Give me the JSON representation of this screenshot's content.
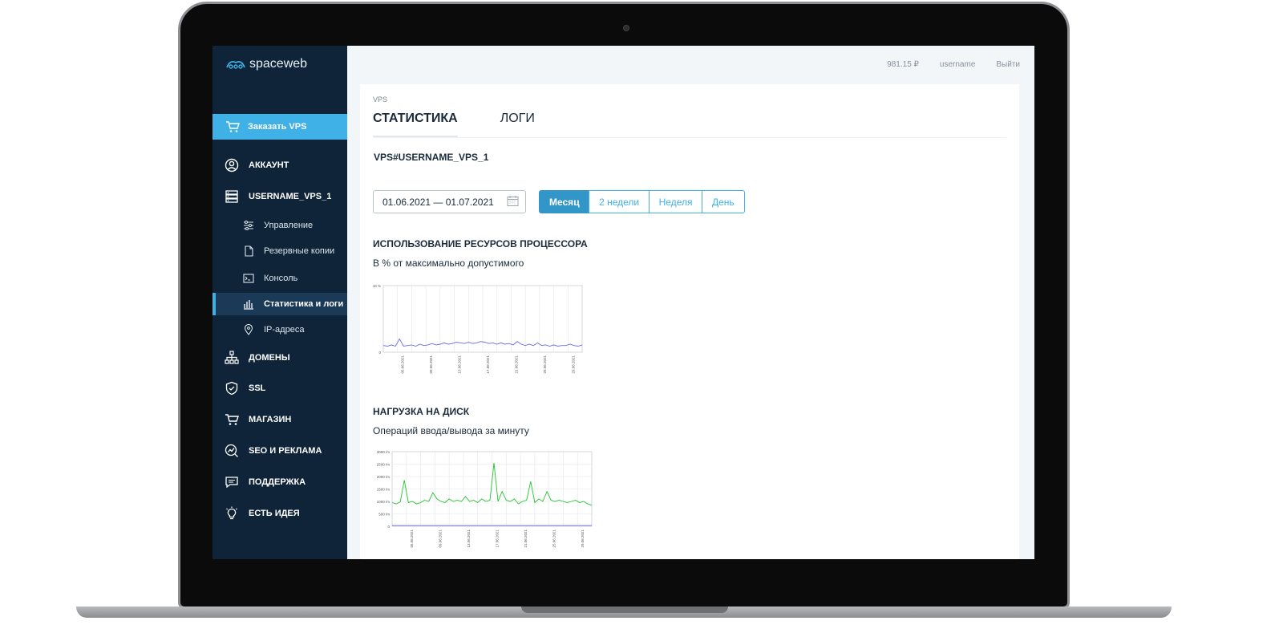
{
  "brand": {
    "name": "spaceweb"
  },
  "sidebar": {
    "order_label": "Заказать VPS",
    "items": [
      {
        "label": "АККАУНТ",
        "icon": "user-circle-icon"
      },
      {
        "label": "USERNAME_VPS_1",
        "icon": "server-icon"
      }
    ],
    "subitems": [
      {
        "label": "Управление",
        "icon": "sliders-icon"
      },
      {
        "label": "Резервные копии",
        "icon": "file-icon"
      },
      {
        "label": "Консоль",
        "icon": "terminal-icon"
      },
      {
        "label": "Статистика и логи",
        "icon": "bar-chart-icon",
        "active": true
      },
      {
        "label": "IP-адреса",
        "icon": "location-pin-icon"
      }
    ],
    "sections": [
      {
        "label": "ДОМЕНЫ",
        "icon": "sitemap-icon"
      },
      {
        "label": "SSL",
        "icon": "shield-icon"
      },
      {
        "label": "МАГАЗИН",
        "icon": "cart-icon"
      },
      {
        "label": "SEO И РЕКЛАМА",
        "icon": "seo-icon"
      },
      {
        "label": "ПОДДЕРЖКА",
        "icon": "chat-icon"
      },
      {
        "label": "ЕСТЬ ИДЕЯ",
        "icon": "lightbulb-icon"
      }
    ]
  },
  "topbar": {
    "balance": "981.15 ₽",
    "username": "username",
    "logout": "Выйти"
  },
  "breadcrumb": "VPS",
  "tabs": [
    {
      "label": "СТАТИСТИКА",
      "active": true
    },
    {
      "label": "ЛОГИ",
      "active": false
    }
  ],
  "vps_name": "VPS#USERNAME_VPS_1",
  "date_range": "01.06.2021 — 01.07.2021",
  "periods": [
    {
      "label": "Месяц",
      "active": true
    },
    {
      "label": "2 недели",
      "active": false
    },
    {
      "label": "Неделя",
      "active": false
    },
    {
      "label": "День",
      "active": false
    }
  ],
  "cpu": {
    "title": "ИСПОЛЬЗОВАНИЕ РЕСУРСОВ ПРОЦЕССОРА",
    "subtitle": "В % от максимально допустимого"
  },
  "disk": {
    "title": "НАГРУЗКА НА ДИСК",
    "subtitle": "Операций ввода/вывода за минуту"
  },
  "colors": {
    "accent": "#3fb1e6",
    "sidebar_bg": "#0f2438",
    "cpu_line": "#6a6ae8",
    "disk_line": "#22c32e"
  },
  "chart_data": [
    {
      "type": "line",
      "ylim": [
        0,
        10
      ],
      "ytick_labels": [
        "10 %",
        "0"
      ],
      "xtick_labels": [
        "05.06.2021",
        "09.06.2021",
        "13.06.2021",
        "17.06.2021",
        "21.06.2021",
        "25.06.2021",
        "29.06.2021"
      ],
      "series": [
        {
          "color": "#6a6ae8",
          "values": [
            1.0,
            0.9,
            1.1,
            0.9,
            2.0,
            0.9,
            1.0,
            1.1,
            0.9,
            1.2,
            1.0,
            1.1,
            1.3,
            1.1,
            1.2,
            1.4,
            1.2,
            1.3,
            1.5,
            1.4,
            1.3,
            1.5,
            1.3,
            1.4,
            1.6,
            1.5,
            1.3,
            1.4,
            1.2,
            1.4,
            1.2,
            1.3,
            1.1,
            1.6,
            1.2,
            1.0,
            1.2,
            1.0,
            1.4,
            1.0,
            1.1,
            0.9,
            1.1,
            0.9,
            1.0,
            1.0,
            1.2,
            1.0,
            0.9,
            1.1
          ]
        }
      ]
    },
    {
      "type": "line",
      "ylim": [
        0,
        3000
      ],
      "ytick_labels": [
        "3000 /m",
        "2500 /m",
        "2000 /m",
        "1500 /m",
        "1000 /m",
        "500 /m",
        "0"
      ],
      "xtick_labels": [
        "05.06.2021",
        "09.06.2021",
        "13.06.2021",
        "17.06.2021",
        "21.06.2021",
        "25.06.2021",
        "29.06.2021"
      ],
      "series": [
        {
          "color": "#22c32e",
          "values": [
            950,
            900,
            980,
            1850,
            950,
            1000,
            900,
            950,
            1050,
            1000,
            1350,
            1100,
            1000,
            950,
            1100,
            1000,
            1050,
            1000,
            1200,
            1000,
            1050,
            950,
            1100,
            1000,
            1050,
            2550,
            1000,
            1400,
            1050,
            1000,
            1100,
            900,
            1000,
            1050,
            1800,
            950,
            1100,
            1000,
            1400,
            1050,
            1000,
            1050,
            1000,
            950,
            1000,
            1050,
            950,
            1000,
            900,
            850
          ]
        },
        {
          "color": "#6a6ae8",
          "values": [
            30,
            30,
            30,
            30,
            30,
            30,
            30,
            30,
            30,
            30,
            30,
            30,
            30,
            30,
            30,
            30,
            30,
            30,
            30,
            30,
            30,
            30,
            30,
            30,
            30,
            30,
            30,
            30,
            30,
            30,
            30,
            30,
            30,
            30,
            30,
            30,
            30,
            30,
            30,
            30,
            30,
            30,
            30,
            30,
            30,
            30,
            30,
            30,
            30,
            30
          ]
        }
      ]
    }
  ]
}
